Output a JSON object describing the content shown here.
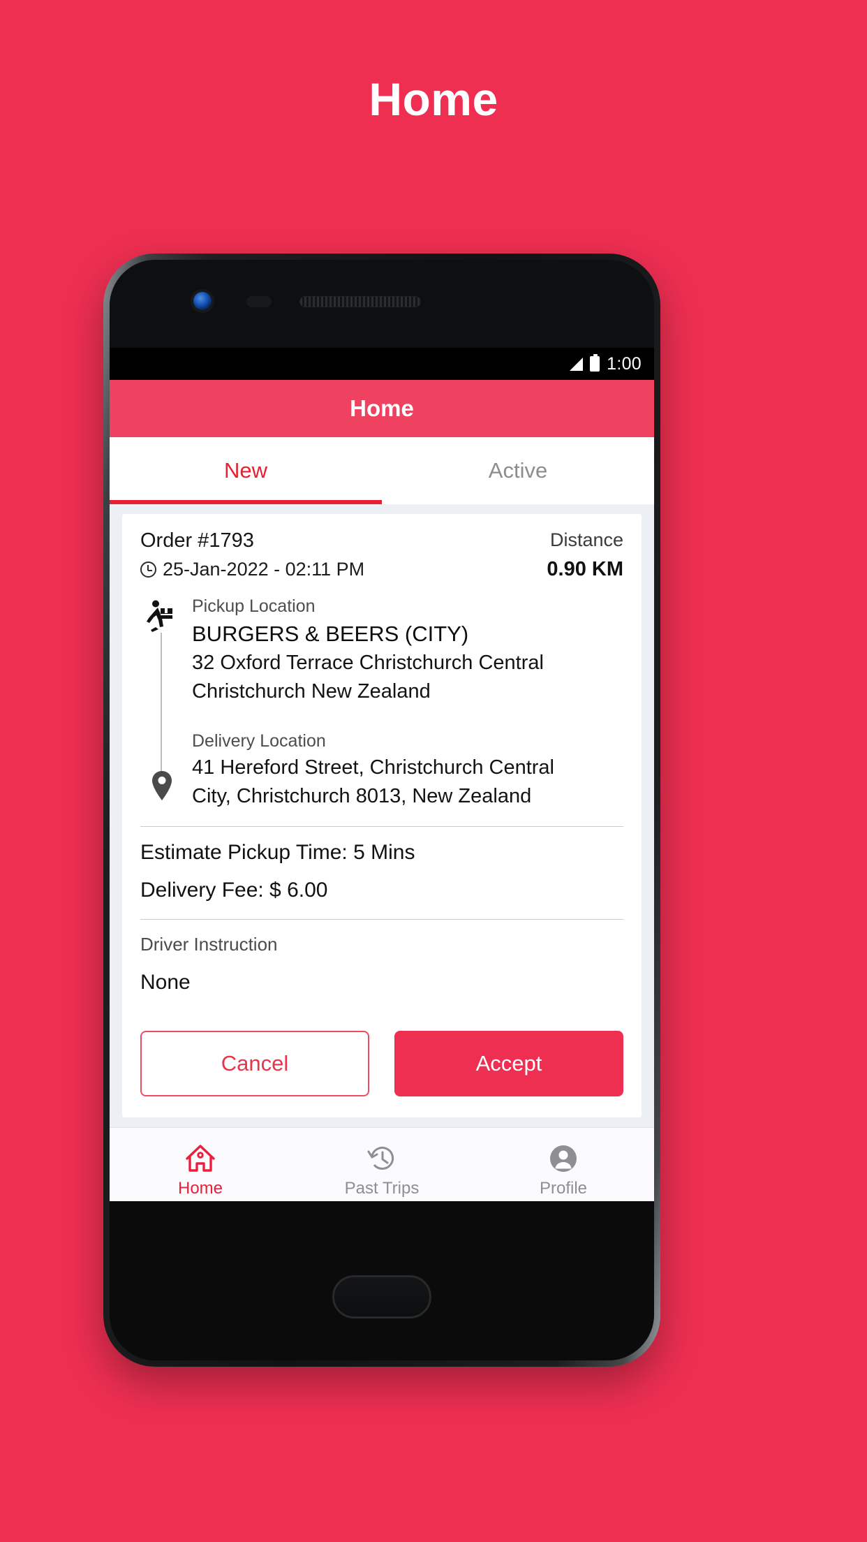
{
  "page": {
    "title": "Home",
    "background_color": "#ee2f52"
  },
  "status_bar": {
    "time": "1:00",
    "signal_icon": "signal-bars-icon",
    "battery_icon": "battery-icon"
  },
  "app_bar": {
    "title": "Home"
  },
  "tabs": [
    {
      "label": "New",
      "active": true
    },
    {
      "label": "Active",
      "active": false
    }
  ],
  "order": {
    "order_number": "Order #1793",
    "clock_icon": "clock-icon",
    "datetime": "25-Jan-2022 - 02:11 PM",
    "distance_label": "Distance",
    "distance_value": "0.90 KM",
    "pickup": {
      "icon": "courier-runner-icon",
      "label": "Pickup Location",
      "name": "BURGERS & BEERS (CITY)",
      "address_line_1": "32 Oxford Terrace  Christchurch Central",
      "address_line_2": "Christchurch  New Zealand"
    },
    "delivery": {
      "icon": "map-pin-icon",
      "label": "Delivery Location",
      "address_line_1": "41 Hereford Street, Christchurch Central",
      "address_line_2": "City, Christchurch 8013, New Zealand"
    },
    "estimate_pickup_time": "Estimate Pickup Time: 5 Mins",
    "delivery_fee": "Delivery Fee: $ 6.00",
    "driver_instruction_label": "Driver Instruction",
    "driver_instruction_value": "None",
    "cancel_button": "Cancel",
    "accept_button": "Accept"
  },
  "bottom_nav": [
    {
      "label": "Home",
      "icon": "home-icon",
      "active": true
    },
    {
      "label": "Past Trips",
      "icon": "history-clock-icon",
      "active": false
    },
    {
      "label": "Profile",
      "icon": "person-icon",
      "active": false
    }
  ],
  "colors": {
    "brand_red": "#ee2f52",
    "appbar_red": "#ee4260",
    "tab_active_red": "#e8202f",
    "muted_gray": "#8e8e93"
  }
}
